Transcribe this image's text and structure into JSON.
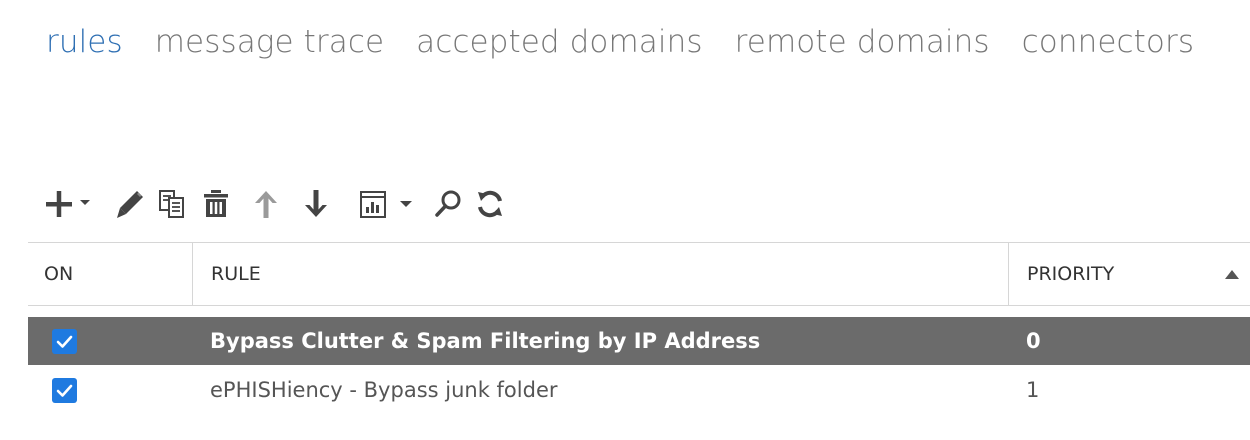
{
  "tabs": [
    {
      "label": "rules",
      "active": true
    },
    {
      "label": "message trace",
      "active": false
    },
    {
      "label": "accepted domains",
      "active": false
    },
    {
      "label": "remote domains",
      "active": false
    },
    {
      "label": "connectors",
      "active": false
    }
  ],
  "toolbar": {
    "icons": [
      "add-icon",
      "dropdown-arrow-icon",
      "edit-icon",
      "copy-icon",
      "delete-icon",
      "move-up-icon",
      "move-down-icon",
      "report-icon",
      "dropdown-arrow-icon",
      "search-icon",
      "refresh-icon"
    ]
  },
  "grid": {
    "columns": [
      "ON",
      "RULE",
      "PRIORITY"
    ],
    "sort": "ascending",
    "rows": [
      {
        "on": true,
        "rule": "Bypass Clutter & Spam Filtering by IP Address",
        "priority": "0",
        "selected": true
      },
      {
        "on": true,
        "rule": "ePHISHiency - Bypass junk folder",
        "priority": "1",
        "selected": false
      }
    ]
  },
  "colors": {
    "active_tab": "#2e6fb3",
    "inactive_tab": "#777777",
    "selected_row": "#6b6b6b",
    "checkbox": "#1f7ae0",
    "icon": "#444444"
  }
}
